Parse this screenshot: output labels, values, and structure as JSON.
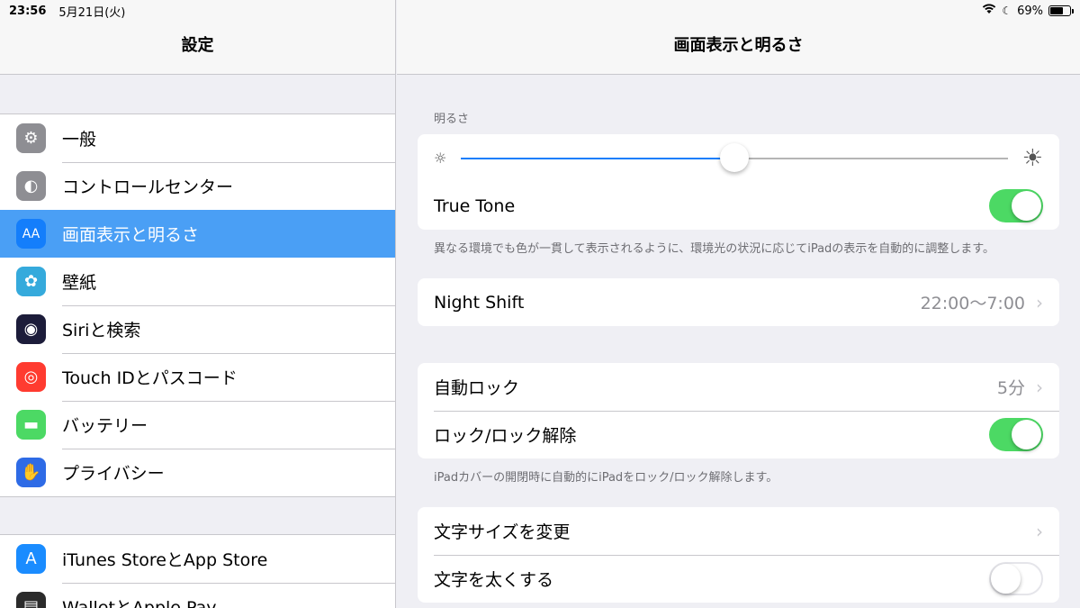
{
  "status": {
    "time": "23:56",
    "date": "5月21日(火)",
    "battery": "69%",
    "battery_level": 0.69
  },
  "sidebar": {
    "title": "設定",
    "group1": [
      {
        "label": "一般",
        "icon": "gear-icon",
        "color": "#8e8e93",
        "glyph": "⚙"
      },
      {
        "label": "コントロールセンター",
        "icon": "toggles-icon",
        "color": "#8e8e93",
        "glyph": "◐"
      },
      {
        "label": "画面表示と明るさ",
        "icon": "text-size-icon",
        "color": "#147efb",
        "glyph": "AA",
        "selected": true
      },
      {
        "label": "壁紙",
        "icon": "flower-icon",
        "color": "#35aadc",
        "glyph": "✿"
      },
      {
        "label": "Siriと検索",
        "icon": "siri-icon",
        "color": "#1c1c3a",
        "glyph": "◉"
      },
      {
        "label": "Touch IDとパスコード",
        "icon": "fingerprint-icon",
        "color": "#ff3b30",
        "glyph": "◎"
      },
      {
        "label": "バッテリー",
        "icon": "battery-icon",
        "color": "#4cd964",
        "glyph": "▬"
      },
      {
        "label": "プライバシー",
        "icon": "hand-icon",
        "color": "#2e6be6",
        "glyph": "✋"
      }
    ],
    "group2": [
      {
        "label": "iTunes StoreとApp Store",
        "icon": "app-store-icon",
        "color": "#1a8cff",
        "glyph": "A"
      },
      {
        "label": "WalletとApple Pay",
        "icon": "wallet-icon",
        "color": "#2b2b2b",
        "glyph": "▤"
      }
    ]
  },
  "detail": {
    "title": "画面表示と明るさ",
    "brightness": {
      "header": "明るさ",
      "level": 0.5,
      "true_tone_label": "True Tone",
      "true_tone_on": true,
      "footer": "異なる環境でも色が一貫して表示されるように、環境光の状況に応じてiPadの表示を自動的に調整します。"
    },
    "night_shift": {
      "label": "Night Shift",
      "value": "22:00〜7:00"
    },
    "lock": {
      "auto_lock_label": "自動ロック",
      "auto_lock_value": "5分",
      "lock_unlock_label": "ロック/ロック解除",
      "lock_unlock_on": true,
      "footer": "iPadカバーの開閉時に自動的にiPadをロック/ロック解除します。"
    },
    "text": {
      "size_label": "文字サイズを変更",
      "bold_label": "文字を太くする",
      "bold_on": false
    }
  }
}
